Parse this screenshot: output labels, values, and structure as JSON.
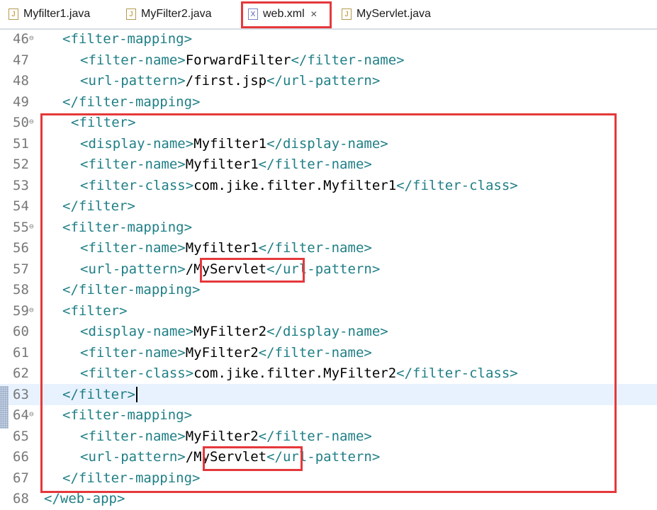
{
  "tabs": [
    {
      "label": "Myfilter1.java",
      "type": "java",
      "active": false
    },
    {
      "label": "MyFilter2.java",
      "type": "java",
      "active": false
    },
    {
      "label": "web.xml",
      "type": "xml",
      "active": true,
      "close": "✕"
    },
    {
      "label": "MyServlet.java",
      "type": "java",
      "active": false
    }
  ],
  "icons": {
    "java_file": "J",
    "xml_file": "X",
    "fold": "⊖"
  },
  "colors": {
    "tag": "#1f7f86",
    "text": "#000000",
    "line_number": "#787878",
    "highlight": "#e5383b",
    "current_line": "#e8f2fe"
  },
  "lines": [
    {
      "n": "46",
      "fold": true,
      "parts": [
        {
          "t": "<filter-mapping>",
          "k": "tag"
        }
      ]
    },
    {
      "n": "47",
      "fold": false,
      "parts": [
        {
          "t": "<filter-name>",
          "k": "tag"
        },
        {
          "t": "ForwardFilter",
          "k": "txt"
        },
        {
          "t": "</filter-name>",
          "k": "tag"
        }
      ]
    },
    {
      "n": "48",
      "fold": false,
      "parts": [
        {
          "t": "<url-pattern>",
          "k": "tag"
        },
        {
          "t": "/first.jsp",
          "k": "txt"
        },
        {
          "t": "</url-pattern>",
          "k": "tag"
        }
      ]
    },
    {
      "n": "49",
      "fold": false,
      "parts": [
        {
          "t": "</filter-mapping>",
          "k": "tag"
        }
      ]
    },
    {
      "n": "50",
      "fold": true,
      "parts": [
        {
          "t": "<filter>",
          "k": "tag"
        }
      ]
    },
    {
      "n": "51",
      "fold": false,
      "parts": [
        {
          "t": "<display-name>",
          "k": "tag"
        },
        {
          "t": "Myfilter1",
          "k": "txt"
        },
        {
          "t": "</display-name>",
          "k": "tag"
        }
      ]
    },
    {
      "n": "52",
      "fold": false,
      "parts": [
        {
          "t": "<filter-name>",
          "k": "tag"
        },
        {
          "t": "Myfilter1",
          "k": "txt"
        },
        {
          "t": "</filter-name>",
          "k": "tag"
        }
      ]
    },
    {
      "n": "53",
      "fold": false,
      "parts": [
        {
          "t": "<filter-class>",
          "k": "tag"
        },
        {
          "t": "com.jike.filter.Myfilter1",
          "k": "txt"
        },
        {
          "t": "</filter-class>",
          "k": "tag"
        }
      ]
    },
    {
      "n": "54",
      "fold": false,
      "parts": [
        {
          "t": "</filter>",
          "k": "tag"
        }
      ]
    },
    {
      "n": "55",
      "fold": true,
      "parts": [
        {
          "t": "<filter-mapping>",
          "k": "tag"
        }
      ]
    },
    {
      "n": "56",
      "fold": false,
      "parts": [
        {
          "t": "<filter-name>",
          "k": "tag"
        },
        {
          "t": "Myfilter1",
          "k": "txt"
        },
        {
          "t": "</filter-name>",
          "k": "tag"
        }
      ]
    },
    {
      "n": "57",
      "fold": false,
      "parts": [
        {
          "t": "<url-pattern>",
          "k": "tag"
        },
        {
          "t": "/MyServlet",
          "k": "txt"
        },
        {
          "t": "</url-pattern>",
          "k": "tag"
        }
      ]
    },
    {
      "n": "58",
      "fold": false,
      "parts": [
        {
          "t": "</filter-mapping>",
          "k": "tag"
        }
      ]
    },
    {
      "n": "59",
      "fold": true,
      "parts": [
        {
          "t": "<filter>",
          "k": "tag"
        }
      ]
    },
    {
      "n": "60",
      "fold": false,
      "parts": [
        {
          "t": "<display-name>",
          "k": "tag"
        },
        {
          "t": "MyFilter2",
          "k": "txt"
        },
        {
          "t": "</display-name>",
          "k": "tag"
        }
      ]
    },
    {
      "n": "61",
      "fold": false,
      "parts": [
        {
          "t": "<filter-name>",
          "k": "tag"
        },
        {
          "t": "MyFilter2",
          "k": "txt"
        },
        {
          "t": "</filter-name>",
          "k": "tag"
        }
      ]
    },
    {
      "n": "62",
      "fold": false,
      "parts": [
        {
          "t": "<filter-class>",
          "k": "tag"
        },
        {
          "t": "com.jike.filter.MyFilter2",
          "k": "txt"
        },
        {
          "t": "</filter-class>",
          "k": "tag"
        }
      ]
    },
    {
      "n": "63",
      "fold": false,
      "current": true,
      "parts": [
        {
          "t": "</filter>",
          "k": "tag"
        }
      ]
    },
    {
      "n": "64",
      "fold": true,
      "parts": [
        {
          "t": "<filter-mapping>",
          "k": "tag"
        }
      ]
    },
    {
      "n": "65",
      "fold": false,
      "parts": [
        {
          "t": "<filter-name>",
          "k": "tag"
        },
        {
          "t": "MyFilter2",
          "k": "txt"
        },
        {
          "t": "</filter-name>",
          "k": "tag"
        }
      ]
    },
    {
      "n": "66",
      "fold": false,
      "parts": [
        {
          "t": "<url-pattern>",
          "k": "tag"
        },
        {
          "t": "/MyServlet",
          "k": "txt"
        },
        {
          "t": "</url-pattern>",
          "k": "tag"
        }
      ]
    },
    {
      "n": "67",
      "fold": false,
      "parts": [
        {
          "t": "</filter-mapping>",
          "k": "tag"
        }
      ]
    },
    {
      "n": "68",
      "fold": false,
      "parts": [
        {
          "t": "</web-app>",
          "k": "tag"
        }
      ]
    }
  ]
}
